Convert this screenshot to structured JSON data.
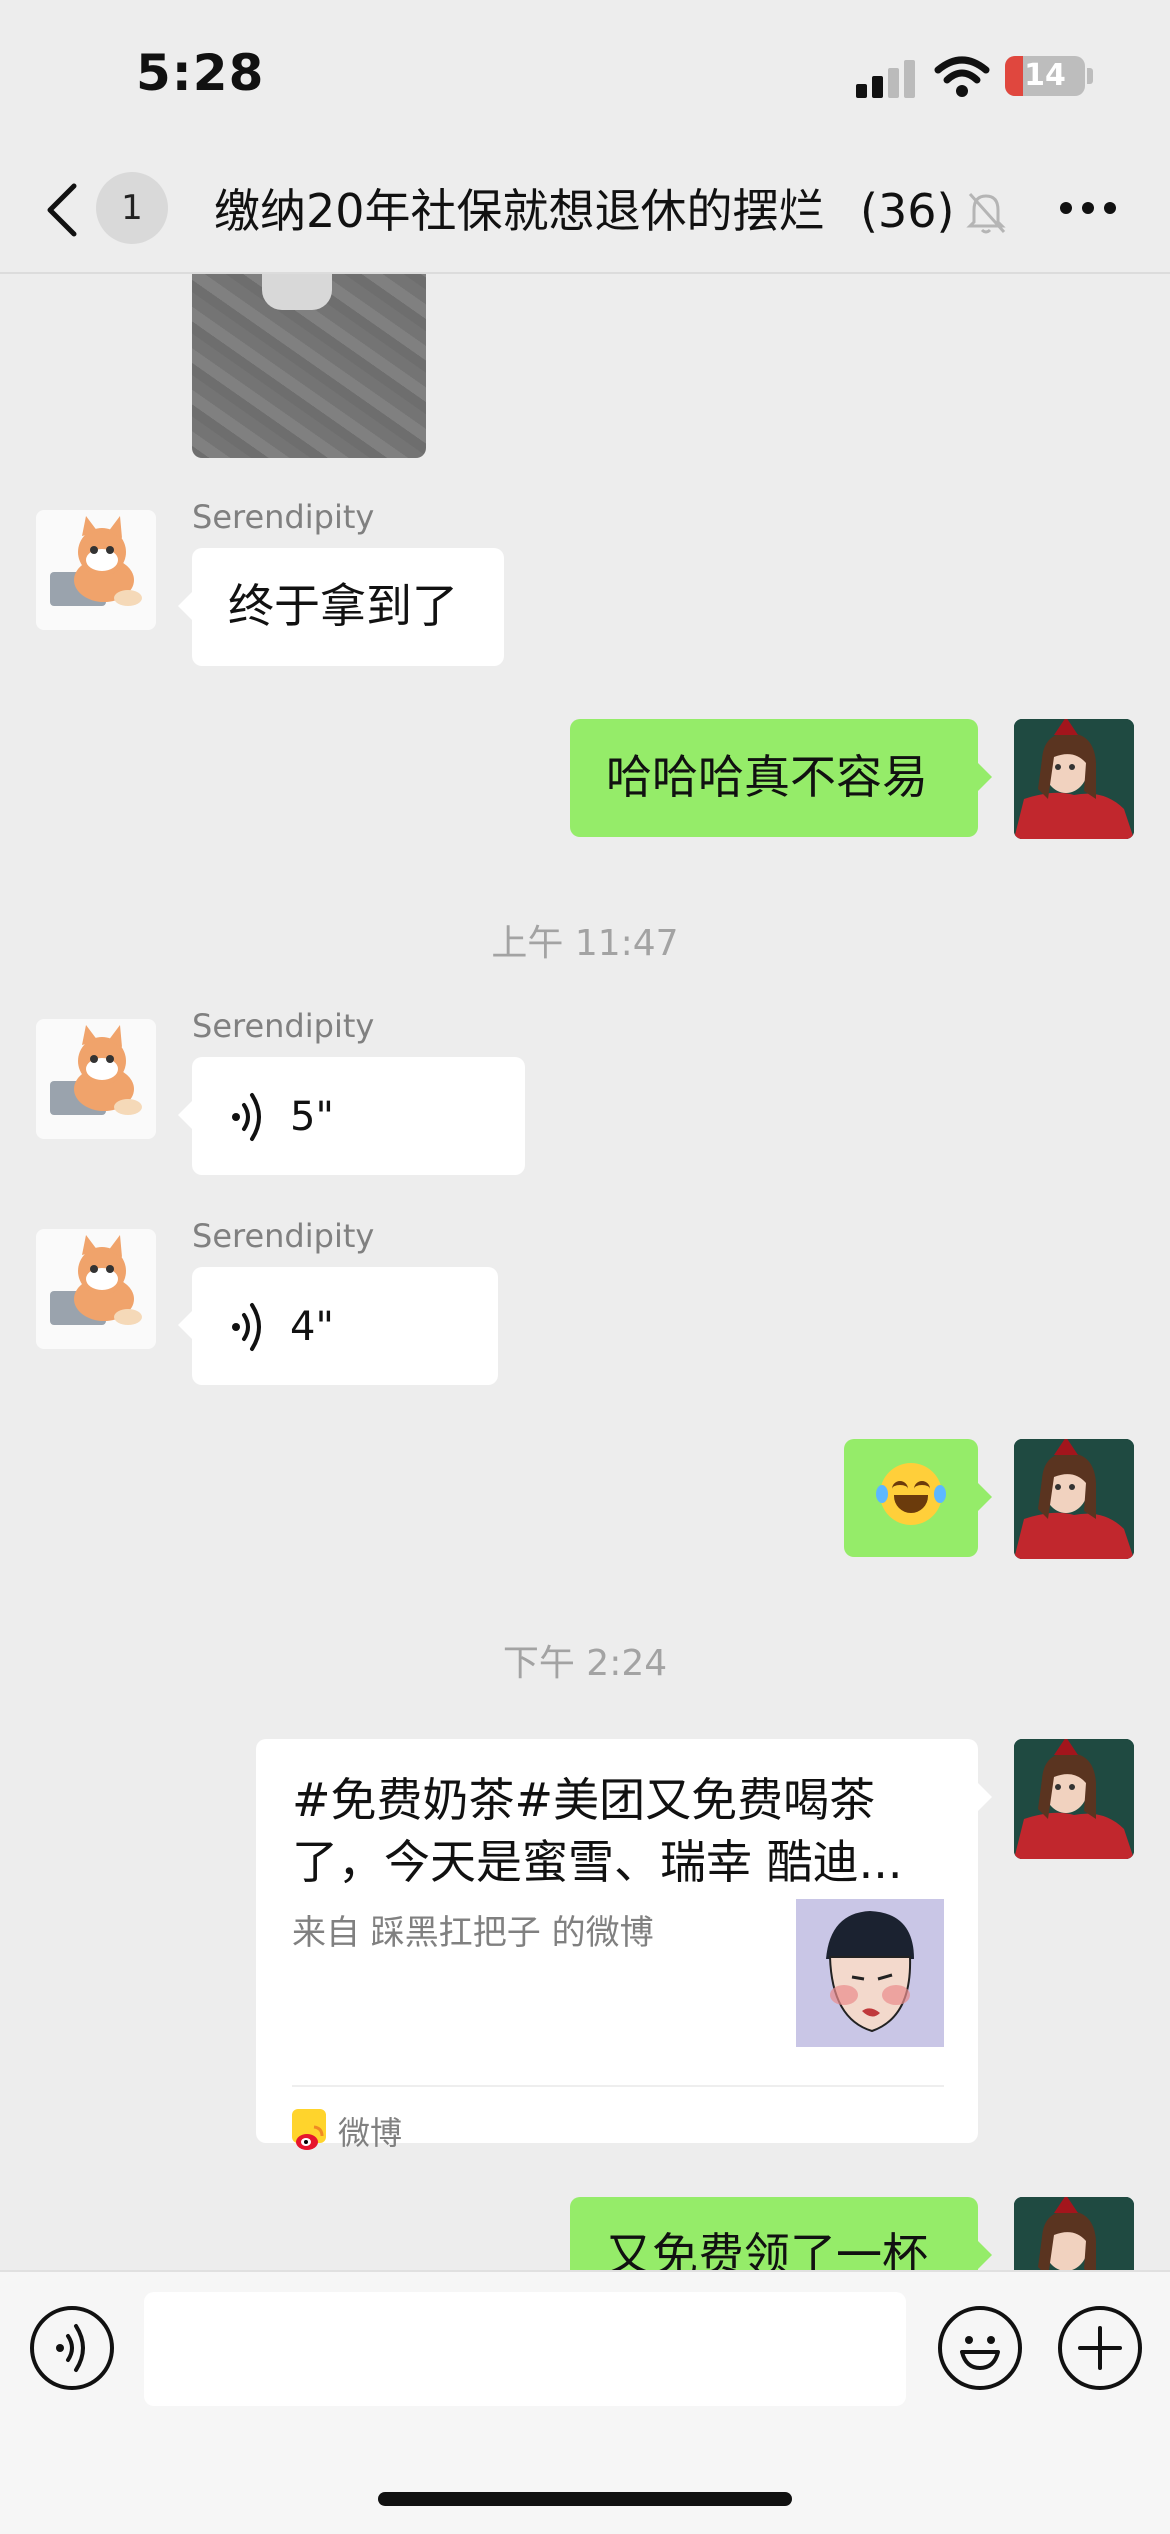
{
  "status_bar": {
    "time": "5:28",
    "battery": "14"
  },
  "nav": {
    "unread_count": "1",
    "title": "缴纳20年社保就想退休的摆烂",
    "member_count": "(36)"
  },
  "messages": {
    "m1": {
      "sender": "Serendipity",
      "text": "终于拿到了"
    },
    "m2": {
      "text": "哈哈哈真不容易"
    },
    "ts1": "上午 11:47",
    "m3": {
      "sender": "Serendipity",
      "duration": "5\""
    },
    "m4": {
      "sender": "Serendipity",
      "duration": "4\""
    },
    "ts2": "下午 2:24",
    "card": {
      "title": "#免费奶茶#美团又免费喝茶了，今天是蜜雪、瑞幸 酷迪...",
      "source": "来自 踩黑扛把子 的微博",
      "app": "微博"
    },
    "m6": {
      "text": "又免费领了一杯"
    }
  },
  "icons": {
    "back": "chevron-left-icon",
    "mute": "bell-off-icon",
    "more": "more-dots-icon",
    "voice": "voice-wave-icon",
    "emoji": "emoji-face-icon",
    "plus": "plus-icon"
  },
  "colors": {
    "outgoing_bubble": "#95EC69",
    "incoming_bubble": "#FFFFFF",
    "background": "#EDEDED"
  }
}
